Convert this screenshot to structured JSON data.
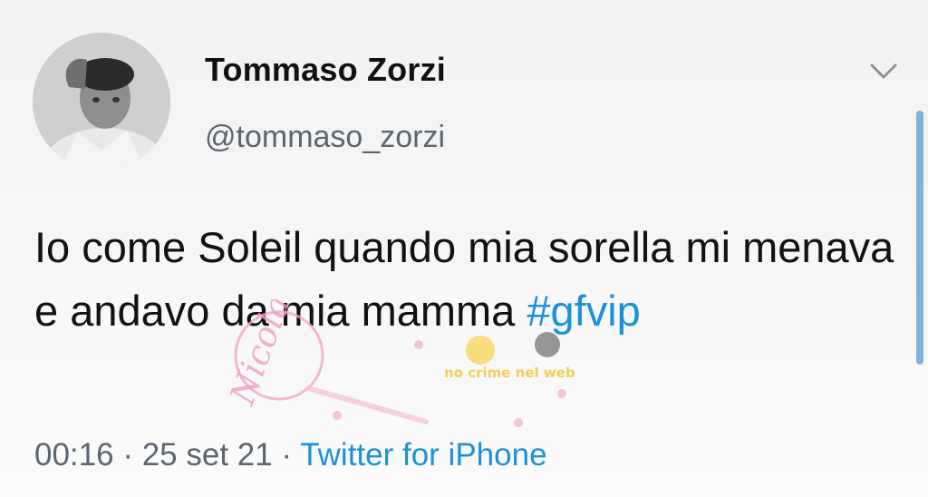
{
  "tweet": {
    "author_name": "Tommaso Zorzi",
    "author_handle": "@tommaso_zorzi",
    "text_before_hashtag": "Io come Soleil quando mia sorella mi menava e andavo da mia mamma ",
    "hashtag": "#gfvip",
    "time": "00:16",
    "separator": " · ",
    "date": "25 set 21",
    "source": "Twitter for iPhone"
  },
  "icons": {
    "more": "chevron-down-icon",
    "avatar": "avatar"
  },
  "watermark": {
    "script_text": "Nicola",
    "banner_text": "no crime nel web"
  },
  "colors": {
    "link": "#1a91da",
    "secondary_text": "#5b6670",
    "primary_text": "#121212",
    "scrollbar": "#7fb3d8"
  }
}
